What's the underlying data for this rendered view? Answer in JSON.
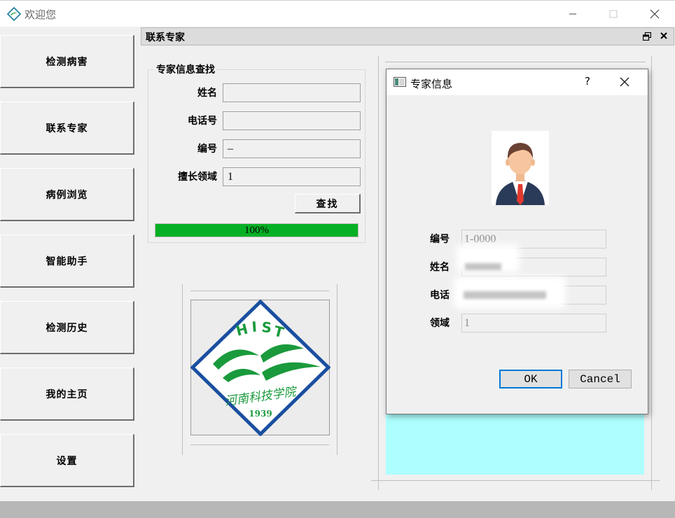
{
  "window": {
    "title": "欢迎您"
  },
  "sidebar": {
    "items": [
      {
        "label": "检测病害"
      },
      {
        "label": "联系专家"
      },
      {
        "label": "病例浏览"
      },
      {
        "label": "智能助手"
      },
      {
        "label": "检测历史"
      },
      {
        "label": "我的主页"
      },
      {
        "label": "设置"
      }
    ]
  },
  "dock": {
    "title": "联系专家"
  },
  "search": {
    "group_title": "专家信息查找",
    "fields": [
      {
        "label": "姓名",
        "value": ""
      },
      {
        "label": "电话号",
        "value": ""
      },
      {
        "label": "编号",
        "value": "–"
      },
      {
        "label": "擅长领域",
        "value": "1"
      }
    ],
    "find_label": "查找",
    "progress": {
      "value": 100,
      "text": "100%"
    }
  },
  "logo": {
    "letters": [
      "H",
      "I",
      "S",
      "T"
    ],
    "calligraphy": "河南科技学院",
    "year": "1939"
  },
  "dialog": {
    "title": "专家信息",
    "help": "?",
    "fields": [
      {
        "label": "编号",
        "value": "1-0000"
      },
      {
        "label": "姓名",
        "value": ""
      },
      {
        "label": "电话",
        "value": ""
      },
      {
        "label": "领域",
        "value": "1"
      }
    ],
    "ok_label": "OK",
    "cancel_label": "Cancel"
  },
  "colors": {
    "progress": "#06b025",
    "cyan_panel": "#adfffe",
    "ok_focus": "#0078d7",
    "logo_blue": "#1a4fa0",
    "logo_green": "#1a9a3c"
  }
}
